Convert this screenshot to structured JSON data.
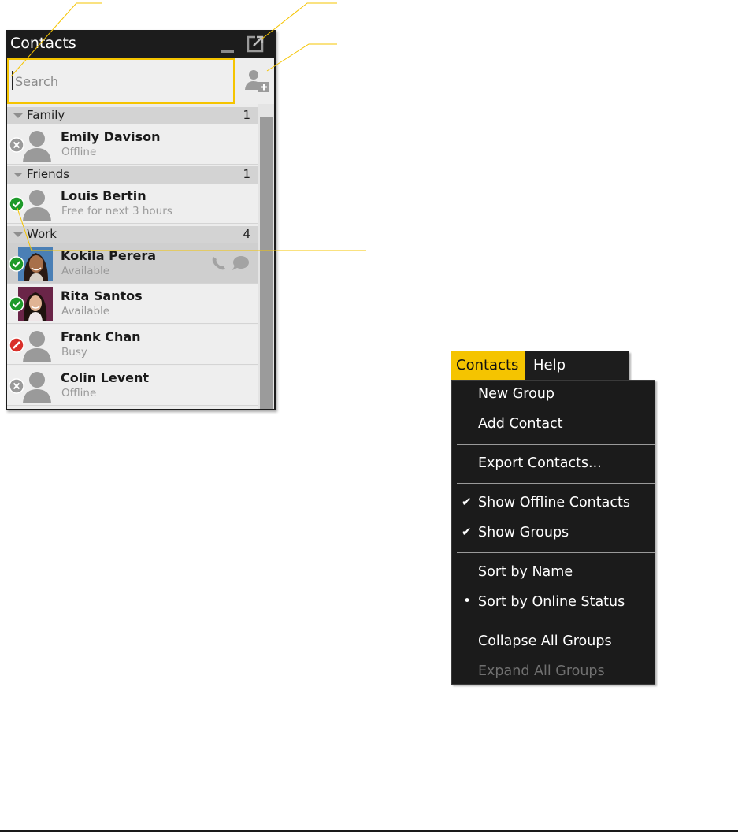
{
  "contacts_window": {
    "title": "Contacts",
    "minimize_icon": "minimize-icon",
    "popout_icon": "popout-icon",
    "search": {
      "placeholder": "Search",
      "value": ""
    },
    "add_contact_icon": "add-contact-icon",
    "groups": [
      {
        "name": "Family",
        "count": "1",
        "contacts": [
          {
            "name": "Emily Davison",
            "status": "Offline",
            "presence": "offline"
          }
        ]
      },
      {
        "name": "Friends",
        "count": "1",
        "contacts": [
          {
            "name": "Louis Bertin",
            "status": "Free for next 3 hours",
            "presence": "available"
          }
        ]
      },
      {
        "name": "Work",
        "count": "4",
        "contacts": [
          {
            "name": "Kokila Perera",
            "status": "Available",
            "presence": "available",
            "has_photo": true,
            "selected": true
          },
          {
            "name": "Rita Santos",
            "status": "Available",
            "presence": "available",
            "has_photo": true
          },
          {
            "name": "Frank Chan",
            "status": "Busy",
            "presence": "busy"
          },
          {
            "name": "Colin Levent",
            "status": "Offline",
            "presence": "offline"
          }
        ]
      }
    ]
  },
  "menubar": {
    "items": [
      "Contacts",
      "Help"
    ],
    "active": "Contacts"
  },
  "contacts_menu": {
    "new_group": "New Group",
    "add_contact": "Add Contact",
    "export_contacts": "Export Contacts...",
    "show_offline": "Show Offline Contacts",
    "show_groups": "Show Groups",
    "sort_by_name": "Sort by Name",
    "sort_by_status": "Sort by Online Status",
    "collapse_all": "Collapse All Groups",
    "expand_all": "Expand All Groups"
  },
  "colors": {
    "accent": "#f5c400",
    "available": "#1e9a2a",
    "busy": "#d9302a",
    "offline": "#9a9a9a",
    "menu_bg": "#1b1b1b"
  }
}
